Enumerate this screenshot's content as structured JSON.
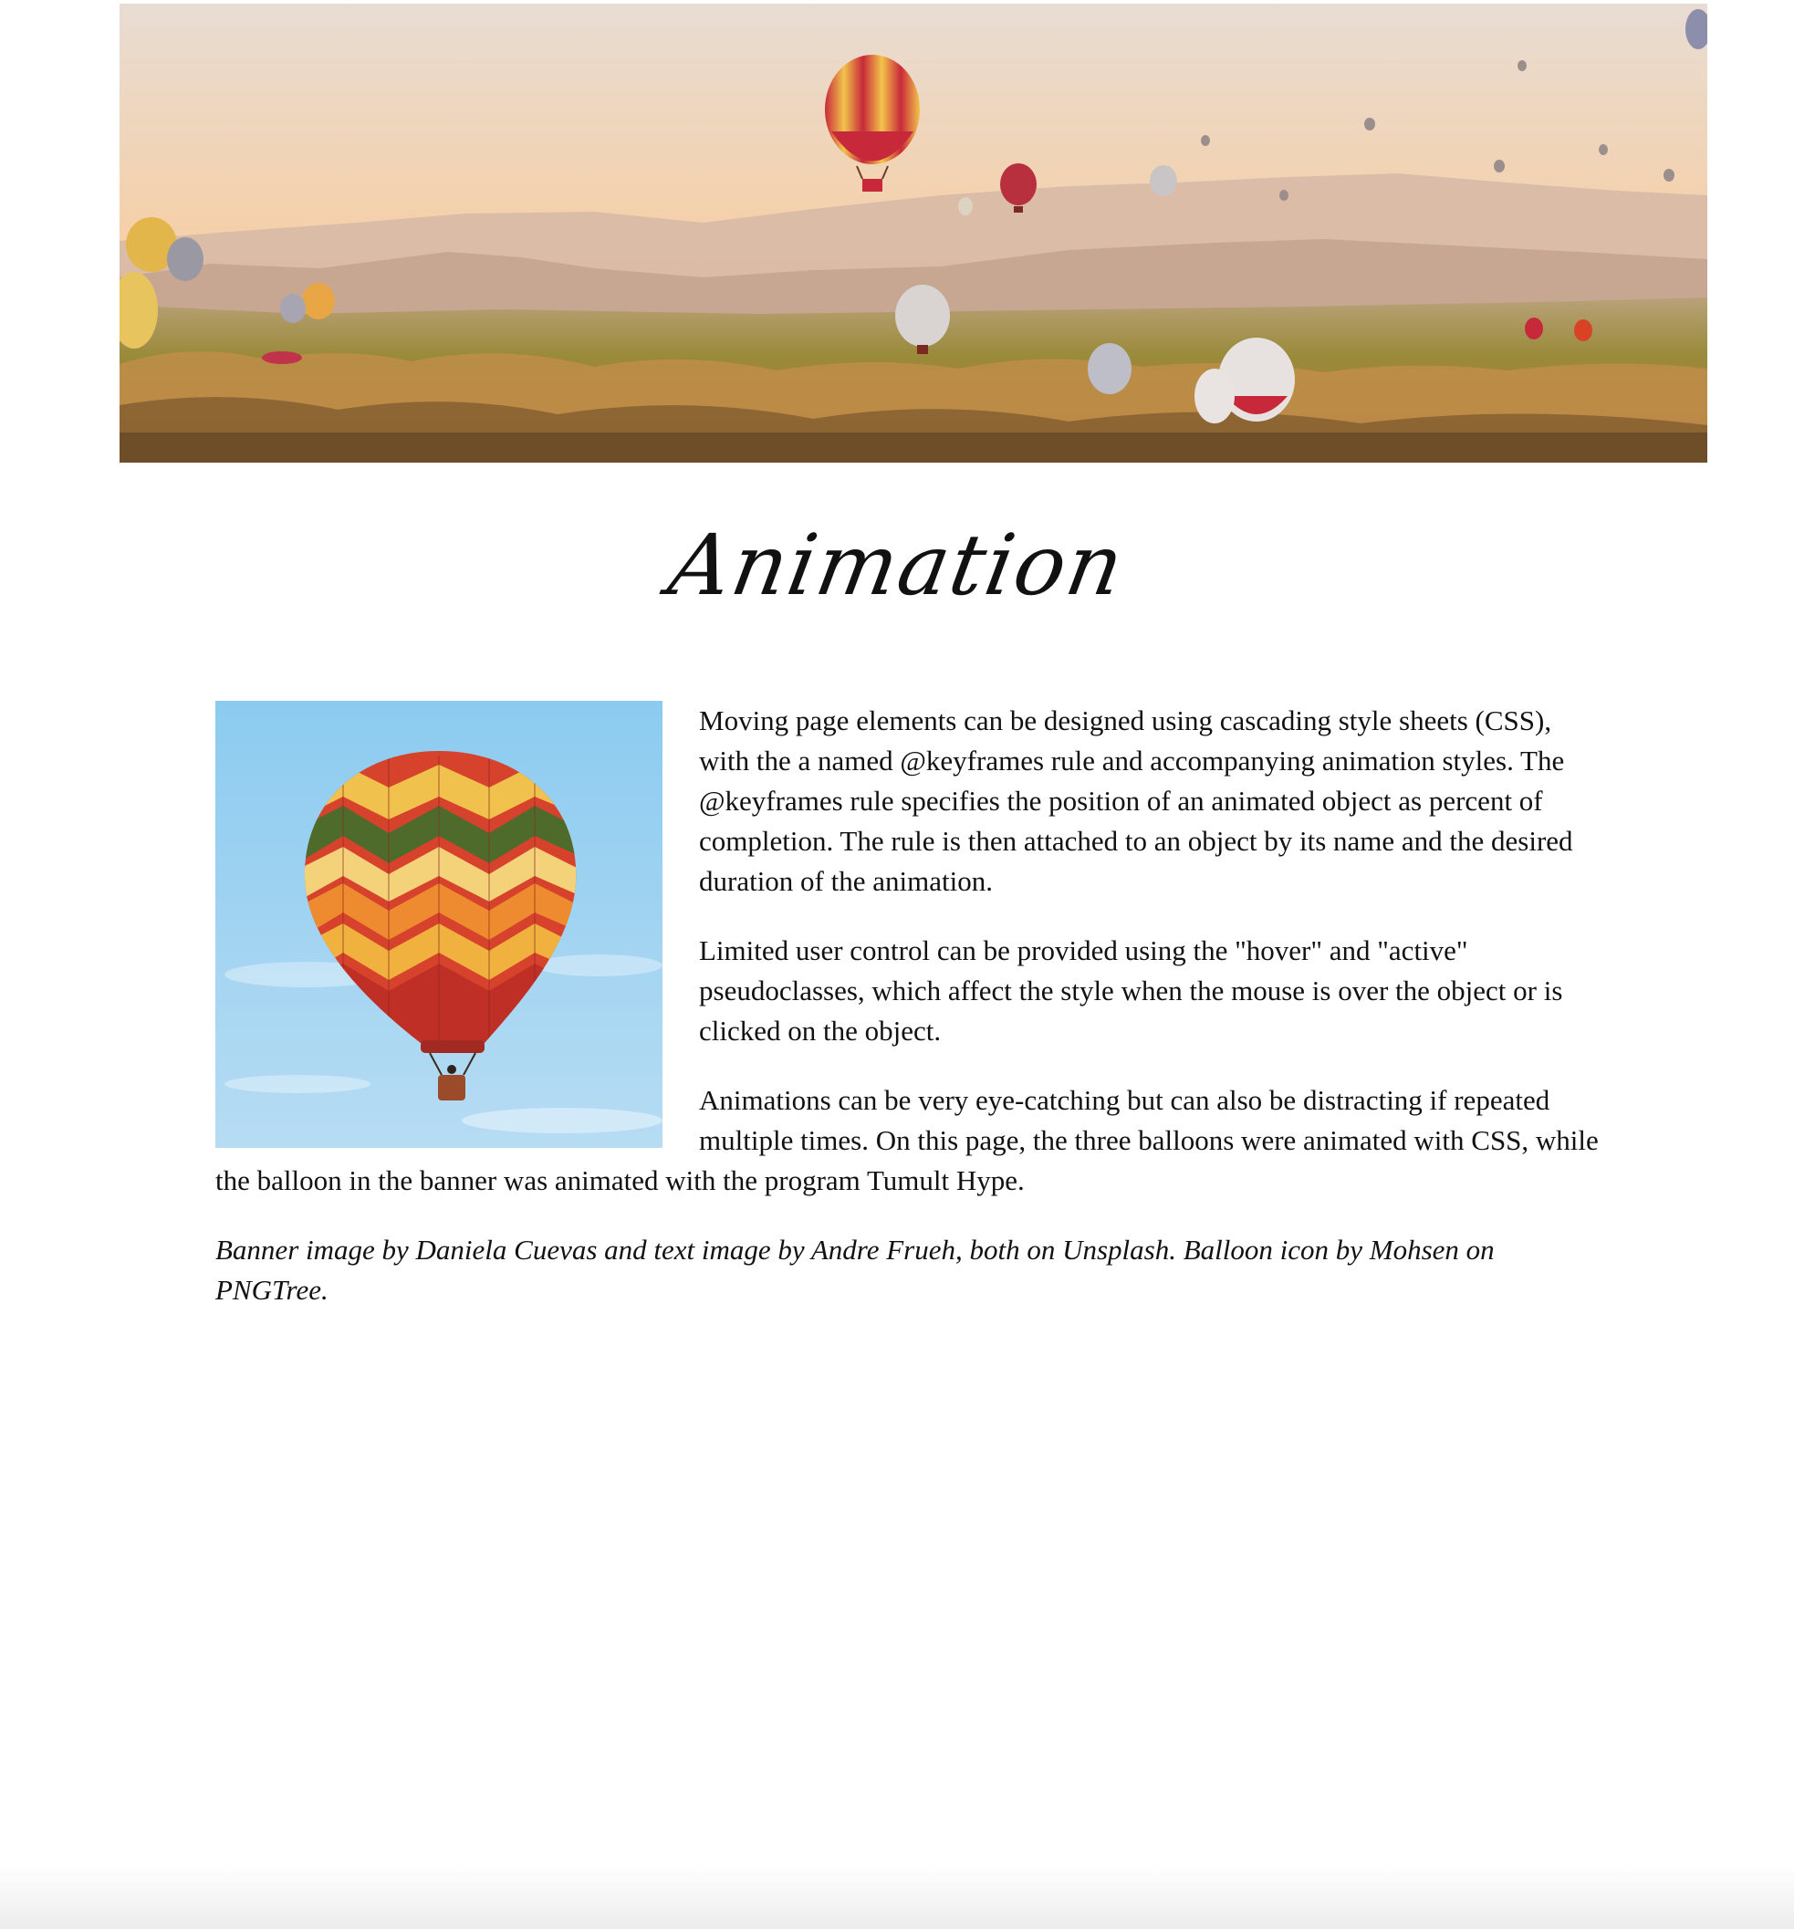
{
  "page": {
    "title": "Animation"
  },
  "banner": {
    "alt": "Hot air balloons over a valley at sunrise"
  },
  "text_image": {
    "alt": "Red, orange and yellow chevron hot air balloon against a blue sky"
  },
  "article": {
    "paragraphs": [
      "Moving page elements can be designed using cascading style sheets (CSS), with the a named @keyframes rule and accompanying animation styles. The @keyframes rule specifies the position of an animated object as percent of completion. The rule is then attached to an object by its name and the desired duration of the animation.",
      "Limited user control can be provided using the \"hover\" and \"active\" pseudoclasses, which affect the style when the mouse is over the object or is clicked on the object.",
      "Animations can be very eye-catching but can also be distracting if repeated multiple times. On this page, the three balloons were animated with CSS, while the balloon in the banner was animated with the program Tumult Hype."
    ],
    "credits": "Banner image by Daniela Cuevas and text image by Andre Frueh, both on Unsplash. Balloon icon by Mohsen on PNGTree."
  },
  "colors": {
    "sky_top": "#e9dcd2",
    "sky_bottom": "#f6c79a",
    "mountain": "#c9a892",
    "valley": "#8d7a2c",
    "balloon_red": "#c8293a",
    "balloon_yellow": "#f0c043",
    "photo_sky": "#8fcaee"
  }
}
